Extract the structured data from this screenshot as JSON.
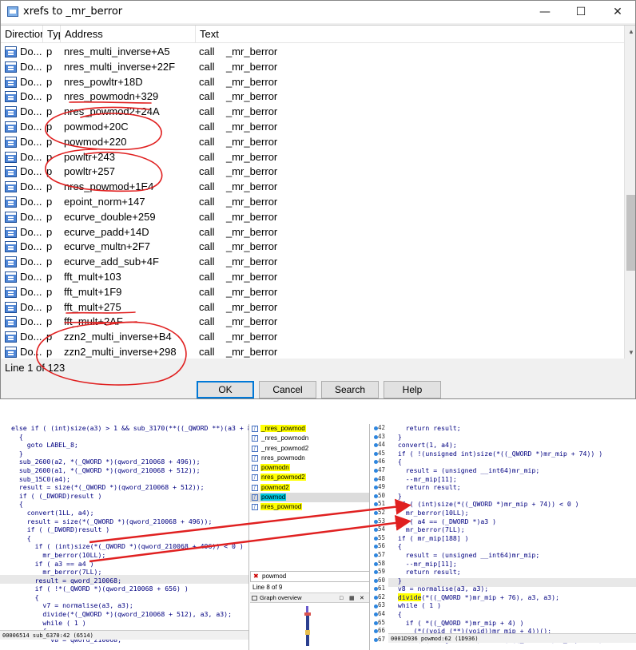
{
  "dialog": {
    "title": "xrefs to _mr_berror",
    "columns": [
      "Directior",
      "Typ",
      "Address",
      "Text"
    ],
    "rows": [
      {
        "dir": "Do...",
        "type": "p",
        "address": "nres_multi_inverse+A5",
        "text": "call    _mr_berror"
      },
      {
        "dir": "Do...",
        "type": "p",
        "address": "nres_multi_inverse+22F",
        "text": "call    _mr_berror"
      },
      {
        "dir": "Do...",
        "type": "p",
        "address": "nres_powltr+18D",
        "text": "call    _mr_berror"
      },
      {
        "dir": "Do...",
        "type": "p",
        "address": "nres_powmodn+329",
        "text": "call    _mr_berror"
      },
      {
        "dir": "Do...",
        "type": "p",
        "address": "nres_powmod2+24A",
        "text": "call    _mr_berror"
      },
      {
        "dir": "Do...",
        "type": "p",
        "address": "powmod+20C",
        "text": "call    _mr_berror"
      },
      {
        "dir": "Do...",
        "type": "p",
        "address": "powmod+220",
        "text": "call    _mr_berror"
      },
      {
        "dir": "Do...",
        "type": "p",
        "address": "powltr+243",
        "text": "call    _mr_berror"
      },
      {
        "dir": "Do...",
        "type": "p",
        "address": "powltr+257",
        "text": "call    _mr_berror"
      },
      {
        "dir": "Do...",
        "type": "p",
        "address": "nres_powmod+1E4",
        "text": "call    _mr_berror"
      },
      {
        "dir": "Do...",
        "type": "p",
        "address": "epoint_norm+147",
        "text": "call    _mr_berror"
      },
      {
        "dir": "Do...",
        "type": "p",
        "address": "ecurve_double+259",
        "text": "call    _mr_berror"
      },
      {
        "dir": "Do...",
        "type": "p",
        "address": "ecurve_padd+14D",
        "text": "call    _mr_berror"
      },
      {
        "dir": "Do...",
        "type": "p",
        "address": "ecurve_multn+2F7",
        "text": "call    _mr_berror"
      },
      {
        "dir": "Do...",
        "type": "p",
        "address": "ecurve_add_sub+4F",
        "text": "call    _mr_berror"
      },
      {
        "dir": "Do...",
        "type": "p",
        "address": "fft_mult+103",
        "text": "call    _mr_berror"
      },
      {
        "dir": "Do...",
        "type": "p",
        "address": "fft_mult+1F9",
        "text": "call    _mr_berror"
      },
      {
        "dir": "Do...",
        "type": "p",
        "address": "fft_mult+275",
        "text": "call    _mr_berror"
      },
      {
        "dir": "Do...",
        "type": "p",
        "address": "fft_mult+2AF",
        "text": "call    _mr_berror"
      },
      {
        "dir": "Do...",
        "type": "p",
        "address": "zzn2_multi_inverse+B4",
        "text": "call    _mr_berror"
      },
      {
        "dir": "Do...",
        "type": "p",
        "address": "zzn2_multi_inverse+298",
        "text": "call    _mr_berror"
      }
    ],
    "status": "Line 1 of 123",
    "buttons": {
      "ok": "OK",
      "cancel": "Cancel",
      "search": "Search",
      "help": "Help"
    }
  },
  "left_code": {
    "lines": [
      "else if ( (int)size(a3) > 1 && sub_3170(**((_QWORD **)(a3 + 8), *(_QW",
      "  {",
      "    goto LABEL_8;",
      "  }",
      "  sub_2600(a2, *(_QWORD *)(qword_210068 + 496));",
      "  sub_2600(a1, *(_QWORD *)(qword_210068 + 512));",
      "  sub_15C0(a4);",
      "  result = size(*(_QWORD *)(qword_210068 + 512));",
      "  if ( (_DWORD)result )",
      "  {",
      "    convert(1LL, a4);",
      "    result = size(*(_QWORD *)(qword_210068 + 496));",
      "    if ( (_DWORD)result )",
      "    {",
      "      if ( (int)size(*(_QWORD *)(qword_210068 + 496)) < 0 )",
      "        mr_berror(10LL);",
      "      if ( a3 == a4 )",
      "        mr_berror(7LL);",
      "      result = qword_210068;",
      "      if ( !*(_QWORD *)(qword_210068 + 656) )",
      "      {",
      "        v7 = normalise(a3, a3);",
      "        divide(*(_QWORD *)(qword_210068 + 512), a3, a3);",
      "        while ( 1 )",
      "        {",
      "          v8 = qword_210068;"
    ],
    "status": "00006514 sub_6370:42 (6514)"
  },
  "functions": {
    "items": [
      {
        "name": "_nres_powmod",
        "hl": "yellow"
      },
      {
        "name": "_nres_powmodn",
        "hl": "none"
      },
      {
        "name": "_nres_powmod2",
        "hl": "none"
      },
      {
        "name": "nres_powmodn",
        "hl": "none"
      },
      {
        "name": "powmodn",
        "hl": "yellow"
      },
      {
        "name": "nres_powmod2",
        "hl": "yellow"
      },
      {
        "name": "powmod2",
        "hl": "yellow"
      },
      {
        "name": "powmod",
        "hl": "cyan"
      },
      {
        "name": "nres_powmod",
        "hl": "yellow"
      }
    ],
    "filter": "powmod",
    "line_info": "Line 8 of 9",
    "graph_title": "Graph overview"
  },
  "right_code": {
    "line_numbers": [
      "42",
      "43",
      "44",
      "45",
      "46",
      "47",
      "48",
      "49",
      "50",
      "51",
      "52",
      "53",
      "54",
      "55",
      "56",
      "57",
      "58",
      "59",
      "60",
      "61",
      "62",
      "63",
      "64",
      "65",
      "66",
      "67"
    ],
    "lines": [
      "    return result;",
      "  }",
      "  convert(1, a4);",
      "  if ( !(unsigned int)size(*((_QWORD *)mr_mip + 74)) )",
      "  {",
      "    result = (unsigned __int64)mr_mip;",
      "    --mr_mip[11];",
      "    return result;",
      "  }",
      "  if ( (int)size(*((_QWORD *)mr_mip + 74)) < 0 )",
      "    mr_berror(10LL);",
      "  if ( a4 == (_DWORD *)a3 )",
      "    mr_berror(7LL);",
      "  if ( mr_mip[188] )",
      "  {",
      "    result = (unsigned __int64)mr_mip;",
      "    --mr_mip[11];",
      "    return result;",
      "  }",
      "  v8 = normalise(a3, a3);",
      "  divide(*((_QWORD *)mr_mip + 76), a3, a3);",
      "  while ( 1 )",
      "  {",
      "    if ( *((_QWORD *)mr_mip + 4) )",
      "      (*((void (**)(void))mr_mip + 4))();",
      "    if ( (unsigned int)subdiv(*((_QWORD *)mr_mip + 74), 2LL, *((_QW"
    ],
    "status": "0001D936 powmod:62 (1D936)"
  }
}
